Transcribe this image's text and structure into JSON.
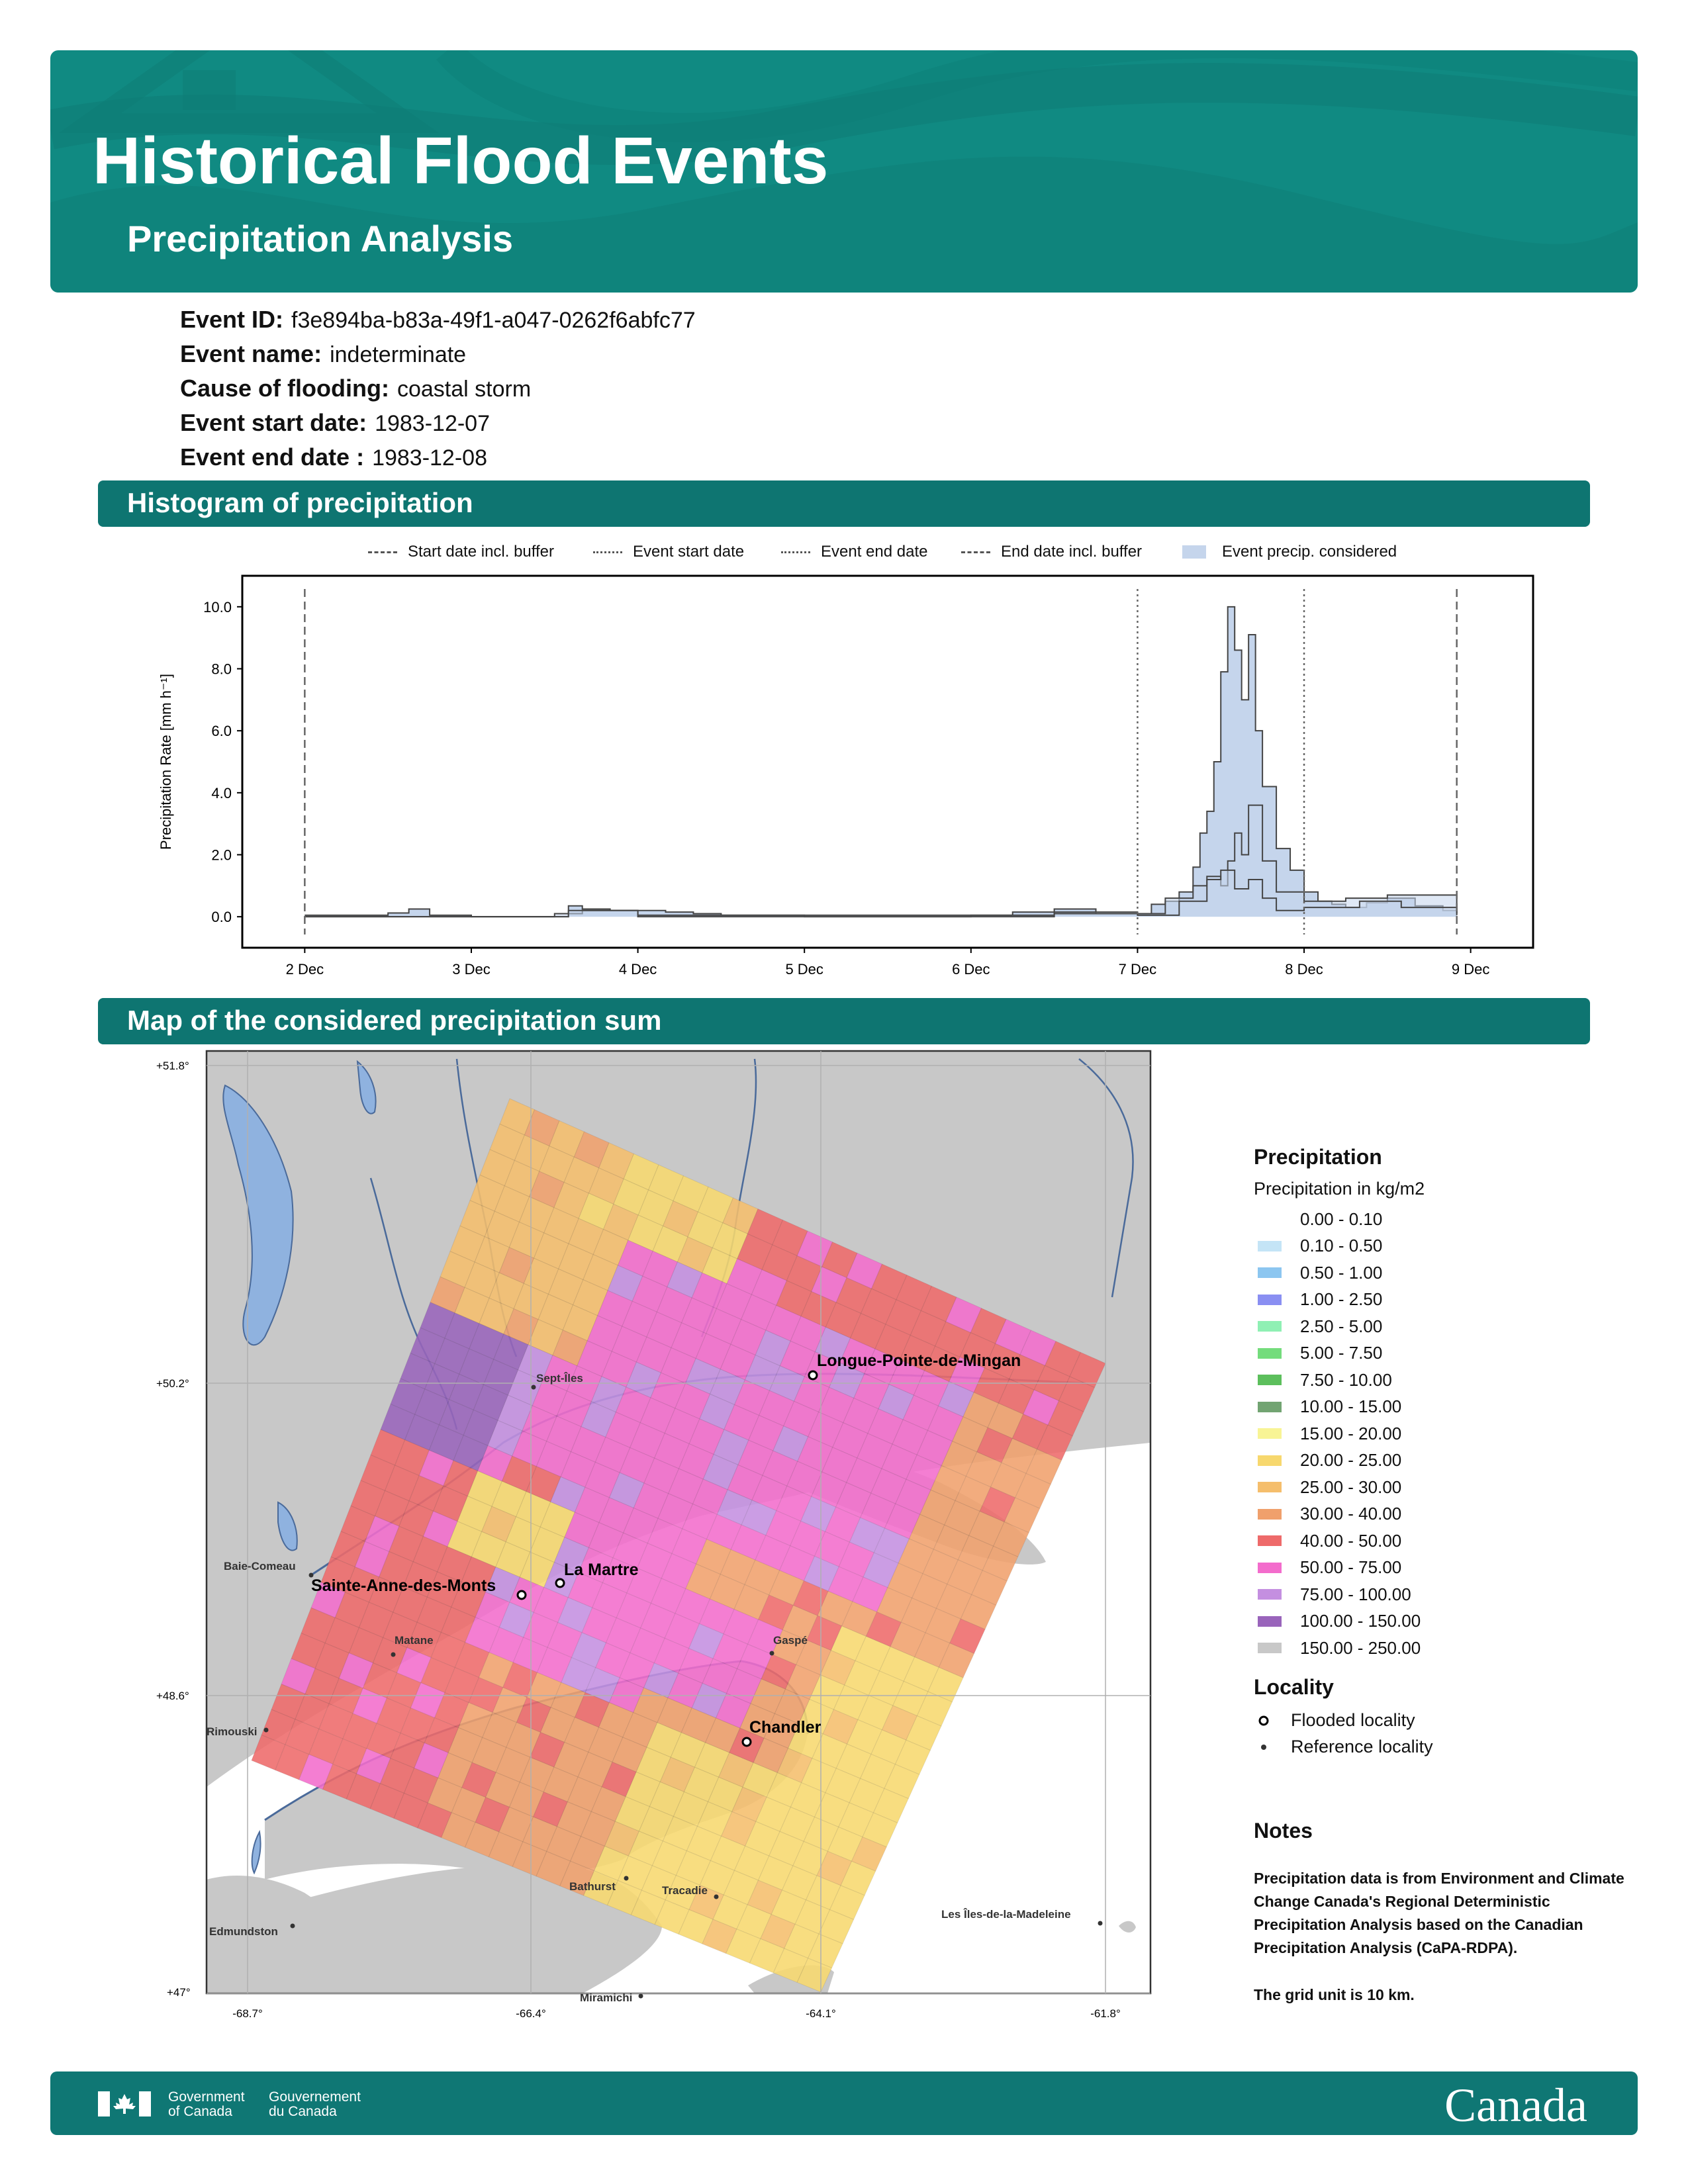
{
  "header": {
    "title": "Historical Flood Events",
    "subtitle": "Precipitation Analysis",
    "background_color": "#108a82"
  },
  "event": {
    "id_label": "Event ID:",
    "id_value": "f3e894ba-b83a-49f1-a047-0262f6abfc77",
    "name_label": "Event name:",
    "name_value": "indeterminate",
    "cause_label": "Cause of flooding:",
    "cause_value": "coastal storm",
    "start_label": "Event start date:",
    "start_value": "1983-12-07",
    "end_label": "Event end date :",
    "end_value": "1983-12-08"
  },
  "sections": {
    "histogram_title": "Histogram of precipitation",
    "map_title": "Map of the considered precipitation sum",
    "bar_color": "#0e7571"
  },
  "histogram_legend": [
    {
      "label": "Start date incl. buffer",
      "style": "dashed"
    },
    {
      "label": "Event start date",
      "style": "dotted"
    },
    {
      "label": "Event end date",
      "style": "dotted"
    },
    {
      "label": "End date incl. buffer",
      "style": "dashed"
    },
    {
      "label": "Event precip. considered",
      "style": "fill"
    }
  ],
  "chart_data": {
    "type": "area",
    "ylabel": "Precipitation Rate [mm h⁻¹]",
    "xlabel": "",
    "ylim": [
      -1.0,
      11.0
    ],
    "xlim": [
      "1983-12-01T15:00",
      "1983-12-09T09:00"
    ],
    "y_ticks": [
      "0.0",
      "2.0",
      "4.0",
      "6.0",
      "8.0",
      "10.0"
    ],
    "x_ticks": [
      "2 Dec",
      "3 Dec",
      "4 Dec",
      "5 Dec",
      "6 Dec",
      "7 Dec",
      "8 Dec",
      "9 Dec"
    ],
    "x_tick_dates": [
      "1983-12-02",
      "1983-12-03",
      "1983-12-04",
      "1983-12-05",
      "1983-12-06",
      "1983-12-07",
      "1983-12-08",
      "1983-12-09"
    ],
    "vertical_lines": [
      {
        "date": "1983-12-02T00:00",
        "style": "dashed"
      },
      {
        "date": "1983-12-07T00:00",
        "style": "dotted"
      },
      {
        "date": "1983-12-08T00:00",
        "style": "dotted"
      },
      {
        "date": "1983-12-08T22:00",
        "style": "dashed"
      }
    ],
    "fill_color": "#c5d5ec",
    "series": [
      {
        "x": [
          "1983-12-02T00:00",
          "1983-12-02T06:00",
          "1983-12-02T12:00",
          "1983-12-02T15:00",
          "1983-12-02T18:00",
          "1983-12-03T00:00",
          "1983-12-03T12:00",
          "1983-12-03T14:00",
          "1983-12-03T16:00",
          "1983-12-03T20:00",
          "1983-12-04T00:00",
          "1983-12-04T04:00",
          "1983-12-04T08:00",
          "1983-12-04T12:00",
          "1983-12-05T00:00",
          "1983-12-05T12:00",
          "1983-12-06T00:00",
          "1983-12-06T06:00",
          "1983-12-06T12:00",
          "1983-12-06T18:00",
          "1983-12-07T00:00",
          "1983-12-07T02:00",
          "1983-12-07T04:00",
          "1983-12-07T06:00",
          "1983-12-07T08:00",
          "1983-12-07T09:00",
          "1983-12-07T10:00",
          "1983-12-07T11:00",
          "1983-12-07T12:00",
          "1983-12-07T13:00",
          "1983-12-07T14:00",
          "1983-12-07T15:00",
          "1983-12-07T16:00",
          "1983-12-07T17:00",
          "1983-12-07T18:00",
          "1983-12-07T20:00",
          "1983-12-07T22:00",
          "1983-12-08T00:00",
          "1983-12-08T02:00",
          "1983-12-08T04:00",
          "1983-12-08T06:00",
          "1983-12-08T09:00",
          "1983-12-08T12:00",
          "1983-12-08T16:00",
          "1983-12-08T20:00",
          "1983-12-08T22:00"
        ],
        "y": [
          0.05,
          0.05,
          0.12,
          0.25,
          0.05,
          0.0,
          0.0,
          0.35,
          0.25,
          0.2,
          0.2,
          0.15,
          0.1,
          0.05,
          0.0,
          0.0,
          0.05,
          0.15,
          0.25,
          0.1,
          0.1,
          0.4,
          0.5,
          0.8,
          1.6,
          2.7,
          3.4,
          5.0,
          7.9,
          10.0,
          8.6,
          7.0,
          9.1,
          6.0,
          4.2,
          2.2,
          1.5,
          0.8,
          0.5,
          0.4,
          0.3,
          0.45,
          0.6,
          0.35,
          0.2,
          0.1
        ]
      },
      {
        "x": [
          "1983-12-02T00:00",
          "1983-12-03T12:00",
          "1983-12-03T16:00",
          "1983-12-04T00:00",
          "1983-12-06T00:00",
          "1983-12-06T12:00",
          "1983-12-07T00:00",
          "1983-12-07T04:00",
          "1983-12-07T08:00",
          "1983-12-07T10:00",
          "1983-12-07T12:00",
          "1983-12-07T13:00",
          "1983-12-07T14:00",
          "1983-12-07T15:00",
          "1983-12-07T16:00",
          "1983-12-07T18:00",
          "1983-12-07T20:00",
          "1983-12-08T00:00",
          "1983-12-08T06:00",
          "1983-12-08T12:00",
          "1983-12-08T22:00"
        ],
        "y": [
          0.0,
          0.1,
          0.2,
          0.05,
          0.05,
          0.15,
          0.1,
          0.6,
          1.0,
          1.3,
          1.0,
          1.8,
          2.7,
          2.0,
          3.6,
          1.8,
          0.8,
          0.5,
          0.6,
          0.7,
          0.1
        ]
      },
      {
        "x": [
          "1983-12-02T00:00",
          "1983-12-03T14:00",
          "1983-12-04T00:00",
          "1983-12-06T12:00",
          "1983-12-07T00:00",
          "1983-12-07T06:00",
          "1983-12-07T10:00",
          "1983-12-07T12:00",
          "1983-12-07T14:00",
          "1983-12-07T16:00",
          "1983-12-07T18:00",
          "1983-12-07T20:00",
          "1983-12-08T00:00",
          "1983-12-08T08:00",
          "1983-12-08T14:00",
          "1983-12-08T22:00"
        ],
        "y": [
          0.0,
          0.2,
          0.0,
          0.1,
          0.05,
          0.5,
          1.2,
          1.5,
          0.9,
          1.2,
          0.6,
          0.2,
          0.3,
          0.5,
          0.3,
          0.05
        ]
      }
    ]
  },
  "map": {
    "lat_labels": [
      "+51.8°",
      "+50.2°",
      "+48.6°",
      "+47°"
    ],
    "lat_values": [
      51.8,
      50.2,
      48.6,
      47.0
    ],
    "lon_labels": [
      "-68.7°",
      "-66.4°",
      "-64.1°",
      "-61.8°"
    ],
    "lon_values": [
      -68.7,
      -66.4,
      -64.1,
      -61.8
    ],
    "grid_cells_along": 24,
    "grid_cells_across": 26,
    "flooded_localities": [
      "Longue-Pointe-de-Mingan",
      "La Martre",
      "Sainte-Anne-des-Monts",
      "Chandler"
    ],
    "reference_localities": [
      "Sept-Îles",
      "Baie-Comeau",
      "Matane",
      "Gaspé",
      "Rimouski",
      "Bathurst",
      "Tracadie",
      "Edmundston",
      "Miramichi",
      "Les Îles-de-la-Madeleine"
    ]
  },
  "map_legend": {
    "title": "Precipitation",
    "subtitle": "Precipitation in kg/m2",
    "classes": [
      {
        "label": "0.00 - 0.10",
        "color": "#ffffff"
      },
      {
        "label": "0.10 - 0.50",
        "color": "#c4e4f6"
      },
      {
        "label": "0.50 - 1.00",
        "color": "#8cc6f0"
      },
      {
        "label": "1.00 - 2.50",
        "color": "#8a8ff2"
      },
      {
        "label": "2.50 - 5.00",
        "color": "#8ff0b4"
      },
      {
        "label": "5.00 - 7.50",
        "color": "#74dc7c"
      },
      {
        "label": "7.50 - 10.00",
        "color": "#5cbf5c"
      },
      {
        "label": "10.00 - 15.00",
        "color": "#72a472"
      },
      {
        "label": "15.00 - 20.00",
        "color": "#f8f495"
      },
      {
        "label": "20.00 - 25.00",
        "color": "#f7d86e"
      },
      {
        "label": "25.00 - 30.00",
        "color": "#f5be6c"
      },
      {
        "label": "30.00 - 40.00",
        "color": "#f0a06c"
      },
      {
        "label": "40.00 - 50.00",
        "color": "#ee6a6a"
      },
      {
        "label": "50.00 - 75.00",
        "color": "#f36ccc"
      },
      {
        "label": "75.00 - 100.00",
        "color": "#c48fe0"
      },
      {
        "label": "100.00 - 150.00",
        "color": "#9964bb"
      },
      {
        "label": "150.00 - 250.00",
        "color": "#c8c8c8"
      }
    ],
    "locality_title": "Locality",
    "flooded_label": "Flooded locality",
    "reference_label": "Reference locality"
  },
  "notes": {
    "title": "Notes",
    "text": "Precipitation data is from Environment and Climate Change Canada's Regional Deterministic Precipitation Analysis based on the Canadian Precipitation Analysis (CaPA-RDPA).",
    "grid_text": "The grid unit is 10 km."
  },
  "footer": {
    "gov_en_1": "Government",
    "gov_en_2": "of Canada",
    "gov_fr_1": "Gouvernement",
    "gov_fr_2": "du Canada",
    "wordmark": "Canada",
    "color": "#0f7774"
  }
}
